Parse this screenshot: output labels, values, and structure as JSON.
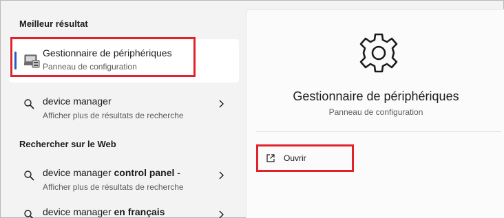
{
  "left_panel": {
    "best_match_heading": "Meilleur résultat",
    "best_match": {
      "title": "Gestionnaire de périphériques",
      "subtitle": "Panneau de configuration",
      "icon": "device-manager-icon"
    },
    "results": [
      {
        "title": "device manager",
        "subtitle": "Afficher plus de résultats de recherche",
        "icon": "search-icon"
      }
    ],
    "web_heading": "Rechercher sur le Web",
    "web_results": [
      {
        "title_plain": "device manager ",
        "title_bold": "control panel",
        "title_tail": " -",
        "subtitle": "Afficher plus de résultats de recherche",
        "icon": "search-icon"
      },
      {
        "title_plain": "device manager ",
        "title_bold": "en français",
        "title_tail": "",
        "subtitle": "",
        "icon": "search-icon"
      }
    ]
  },
  "right_panel": {
    "icon": "gear-icon",
    "title": "Gestionnaire de périphériques",
    "subtitle": "Panneau de configuration",
    "actions": [
      {
        "label": "Ouvrir",
        "icon": "open-external-icon"
      }
    ]
  },
  "colors": {
    "highlight_box": "#e2222b",
    "accent": "#1f5fc4"
  }
}
